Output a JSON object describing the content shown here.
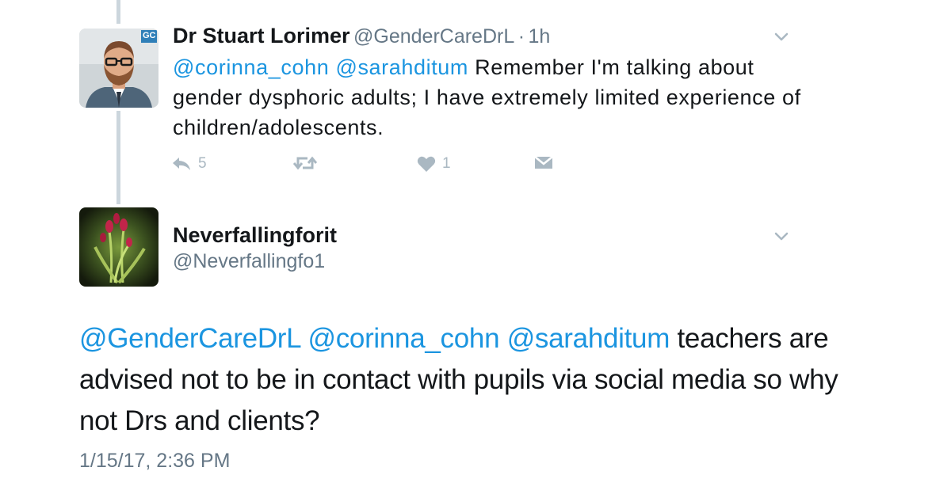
{
  "reply_tweet": {
    "display_name": "Dr Stuart Lorimer",
    "handle": "@GenderCareDrL",
    "separator": "·",
    "time_ago": "1h",
    "avatar_badge": "GC",
    "text": {
      "mention_1": "@corinna_cohn",
      "mention_2": "@sarahditum",
      "body": " Remember I'm talking about gender dysphoric adults; I have extremely limited experience of children/adolescents."
    },
    "actions": {
      "reply_count": "5",
      "like_count": "1"
    }
  },
  "main_tweet": {
    "display_name": "Neverfallingforit",
    "handle": "@Neverfallingfo1",
    "text": {
      "mention_1": "@GenderCareDrL",
      "mention_2": "@corinna_cohn",
      "mention_3": "@sarahditum",
      "body": " teachers are advised not to be in contact with pupils via social media so why not Drs and clients?"
    },
    "timestamp": "1/15/17, 2:36 PM"
  },
  "colors": {
    "link": "#1b95e0",
    "secondary_text": "#657786",
    "icon_gray": "#aab8c2",
    "thread_line": "#ccd6dd"
  },
  "icons": {
    "reply": "reply-icon",
    "retweet": "retweet-icon",
    "like": "heart-icon",
    "dm": "envelope-icon",
    "menu": "chevron-down-icon"
  }
}
